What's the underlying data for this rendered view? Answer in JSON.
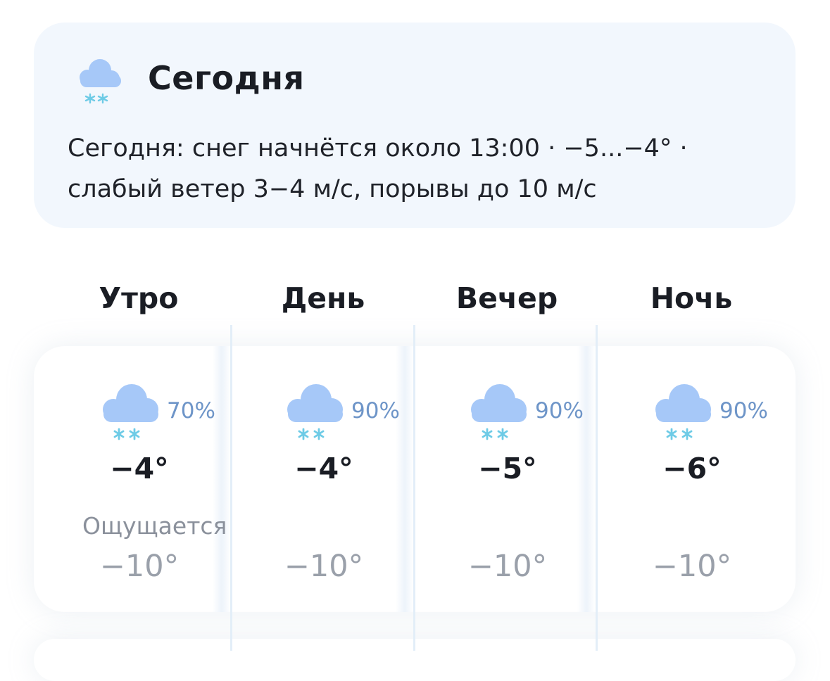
{
  "summary": {
    "icon": "cloud-snow-icon",
    "title": "Сегодня",
    "line1": "Сегодня: снег начнётся около 13:00 · −5...−4° ·",
    "line2": "слабый ветер 3−4 м/с, порывы до 10 м/с"
  },
  "feels_label": "Ощущается",
  "periods": [
    {
      "name": "Утро",
      "icon": "cloud-snow-icon",
      "probability": "70%",
      "temp": "−4°",
      "feels": "−10°"
    },
    {
      "name": "День",
      "icon": "cloud-snow-icon",
      "probability": "90%",
      "temp": "−4°",
      "feels": "−10°"
    },
    {
      "name": "Вечер",
      "icon": "cloud-snow-icon",
      "probability": "90%",
      "temp": "−5°",
      "feels": "−10°"
    },
    {
      "name": "Ночь",
      "icon": "cloud-snow-icon",
      "probability": "90%",
      "temp": "−6°",
      "feels": "−10°"
    }
  ],
  "colors": {
    "cloud": "#a6c8f8",
    "snowflake": "#6ecbe6",
    "probability": "#6e95c8",
    "card_bg": "#f2f7fd"
  }
}
